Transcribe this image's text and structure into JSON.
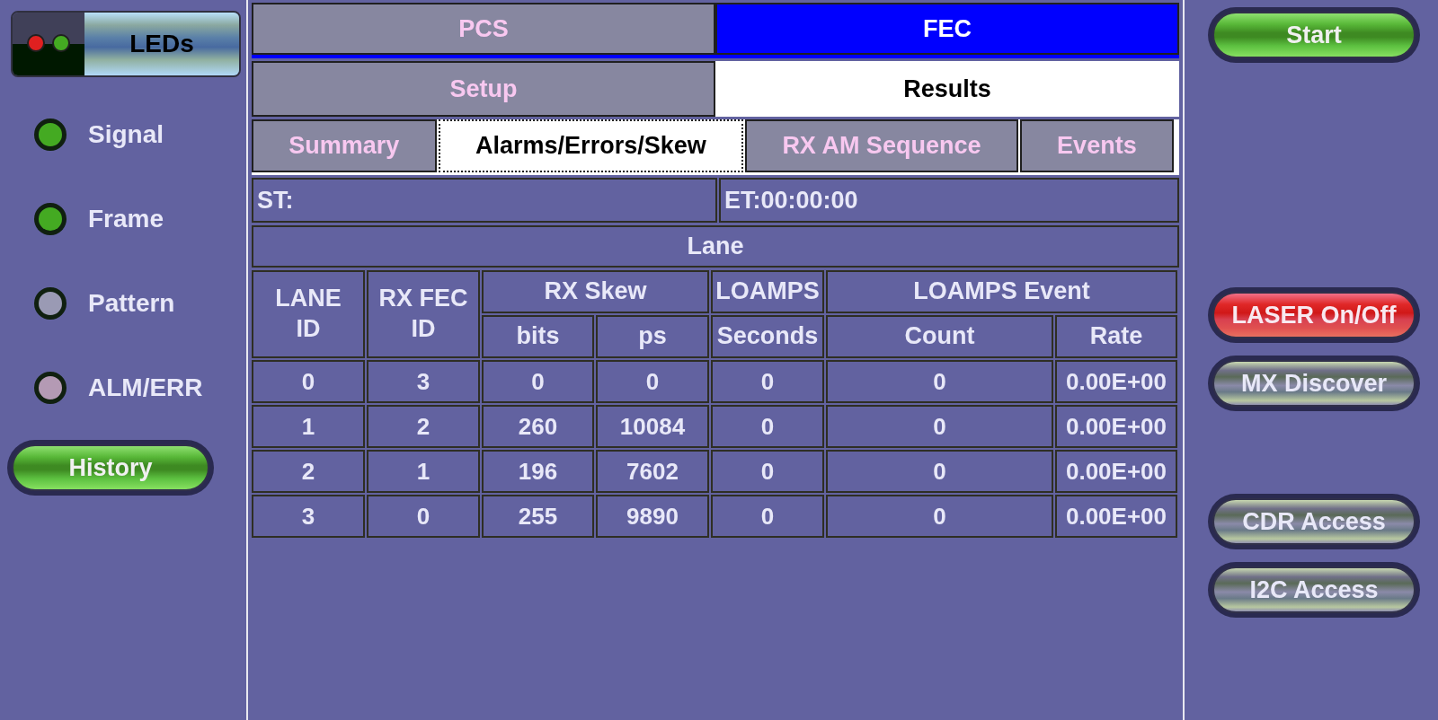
{
  "leds_header": {
    "label": "LEDs"
  },
  "leds": [
    {
      "label": "Signal",
      "color": "#44aa22"
    },
    {
      "label": "Frame",
      "color": "#44aa22"
    },
    {
      "label": "Pattern",
      "color": "#9a9ab4"
    },
    {
      "label": "ALM/ERR",
      "color": "#b49ab4"
    }
  ],
  "history_button": "History",
  "tabs_top": [
    {
      "label": "PCS",
      "selected": false
    },
    {
      "label": "FEC",
      "selected": true
    }
  ],
  "tabs_mid": [
    {
      "label": "Setup",
      "selected": false
    },
    {
      "label": "Results",
      "selected": true
    }
  ],
  "tabs_sub": [
    {
      "label": "Summary",
      "selected": false
    },
    {
      "label": "Alarms/Errors/Skew",
      "selected": true
    },
    {
      "label": "RX AM Sequence",
      "selected": false
    },
    {
      "label": "Events",
      "selected": false
    }
  ],
  "start_time": "ST:",
  "elapsed_time": "ET:00:00:00",
  "table": {
    "title": "Lane",
    "header_top": [
      "LANE ID",
      "RX FEC ID",
      "RX Skew",
      "LOAMPS",
      "LOAMPS Event"
    ],
    "header_sub": [
      "bits",
      "ps",
      "Seconds",
      "Count",
      "Rate"
    ],
    "rows": [
      [
        "0",
        "3",
        "0",
        "0",
        "0",
        "0",
        "0.00E+00"
      ],
      [
        "1",
        "2",
        "260",
        "10084",
        "0",
        "0",
        "0.00E+00"
      ],
      [
        "2",
        "1",
        "196",
        "7602",
        "0",
        "0",
        "0.00E+00"
      ],
      [
        "3",
        "0",
        "255",
        "9890",
        "0",
        "0",
        "0.00E+00"
      ]
    ]
  },
  "buttons": [
    {
      "label": "Start",
      "kind": "go"
    },
    {
      "label": "LASER On/Off",
      "kind": "alert"
    },
    {
      "label": "MX Discover",
      "kind": "plain"
    },
    {
      "label": "CDR Access",
      "kind": "plain"
    },
    {
      "label": "I2C Access",
      "kind": "plain"
    }
  ]
}
